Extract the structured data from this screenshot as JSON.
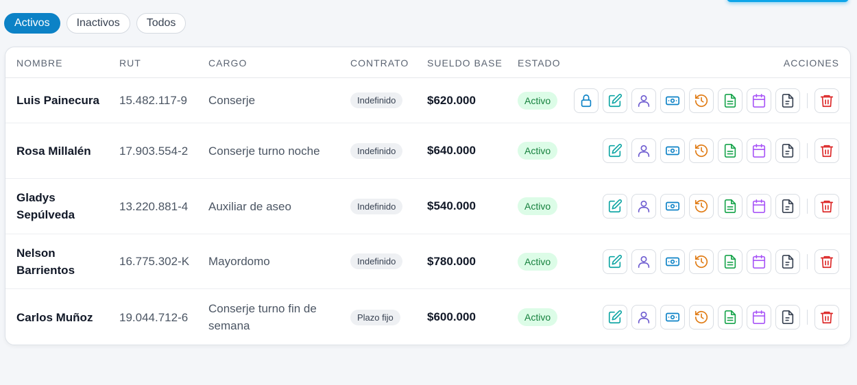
{
  "filters": [
    {
      "label": "Activos",
      "active": true
    },
    {
      "label": "Inactivos",
      "active": false
    },
    {
      "label": "Todos",
      "active": false
    }
  ],
  "table": {
    "headers": {
      "nombre": "NOMBRE",
      "rut": "RUT",
      "cargo": "CARGO",
      "contrato": "CONTRATO",
      "sueldo": "SUELDO BASE",
      "estado": "ESTADO",
      "acciones": "ACCIONES"
    },
    "rows": [
      {
        "nombre": "Luis Painecura",
        "rut": "15.482.117-9",
        "cargo": "Conserje",
        "contrato": "Indefinido",
        "sueldo": "$620.000",
        "estado": "Activo",
        "show_lock": true
      },
      {
        "nombre": "Rosa Millalén",
        "rut": "17.903.554-2",
        "cargo": "Conserje turno noche",
        "contrato": "Indefinido",
        "sueldo": "$640.000",
        "estado": "Activo",
        "show_lock": false
      },
      {
        "nombre": "Gladys Sepúlveda",
        "rut": "13.220.881-4",
        "cargo": "Auxiliar de aseo",
        "contrato": "Indefinido",
        "sueldo": "$540.000",
        "estado": "Activo",
        "show_lock": false
      },
      {
        "nombre": "Nelson Barrientos",
        "rut": "16.775.302-K",
        "cargo": "Mayordomo",
        "contrato": "Indefinido",
        "sueldo": "$780.000",
        "estado": "Activo",
        "show_lock": false
      },
      {
        "nombre": "Carlos Muñoz",
        "rut": "19.044.712-6",
        "cargo": "Conserje turno fin de semana",
        "contrato": "Plazo fijo",
        "sueldo": "$600.000",
        "estado": "Activo",
        "show_lock": false
      }
    ]
  },
  "action_icons": [
    "lock-icon",
    "edit-icon",
    "user-icon",
    "cash-icon",
    "history-icon",
    "document-icon",
    "calendar-icon",
    "file-text-icon",
    "trash-icon"
  ],
  "colors": {
    "primary": "#0c82c6",
    "active_badge_bg": "#dcfce7",
    "active_badge_text": "#15803d",
    "delete": "#dc2626"
  }
}
